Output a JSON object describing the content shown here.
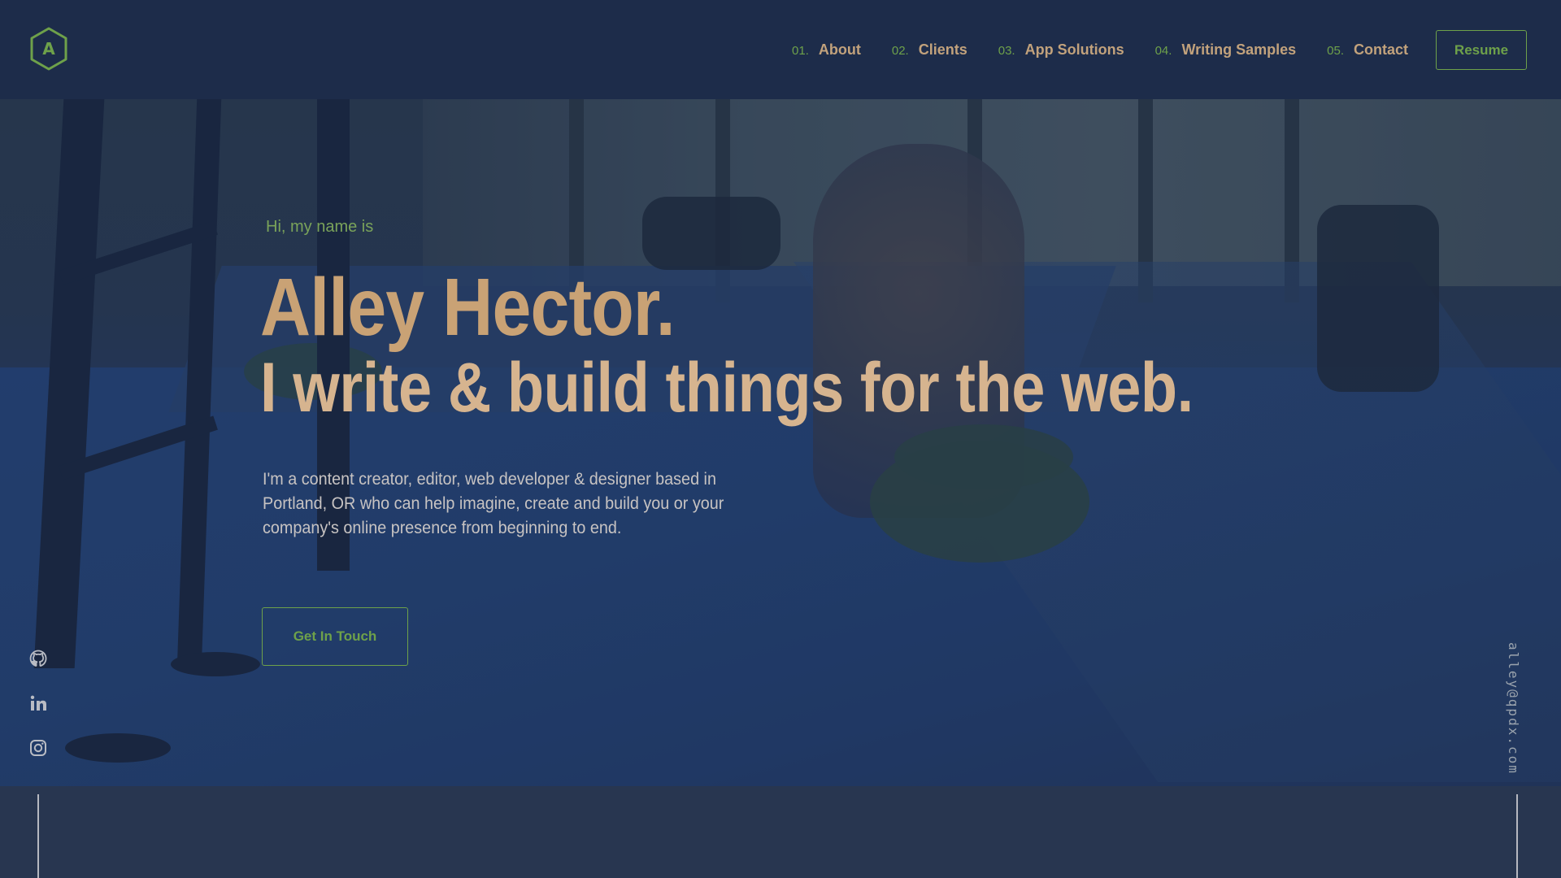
{
  "header": {
    "logo_letter": "A",
    "nav": [
      {
        "num": "01.",
        "label": "About"
      },
      {
        "num": "02.",
        "label": "Clients"
      },
      {
        "num": "03.",
        "label": "App Solutions"
      },
      {
        "num": "04.",
        "label": "Writing Samples"
      },
      {
        "num": "05.",
        "label": "Contact"
      }
    ],
    "resume_label": "Resume"
  },
  "hero": {
    "greeting": "Hi, my name is",
    "name": "Alley Hector.",
    "tagline": "I write & build things for the web.",
    "description": "I'm a content creator, editor, web developer & designer based in Portland, OR who can help imagine, create and build you or your company's online presence from beginning to end.",
    "cta_label": "Get In Touch"
  },
  "sidebar": {
    "socials": [
      {
        "icon": "github-icon"
      },
      {
        "icon": "linkedin-icon"
      },
      {
        "icon": "instagram-icon"
      }
    ],
    "email": "alley@qpdx.com"
  },
  "colors": {
    "background": "#1d2c4a",
    "accent_green": "#6ea14a",
    "accent_tan": "#c9a275",
    "text_muted": "#c7c3c2"
  }
}
